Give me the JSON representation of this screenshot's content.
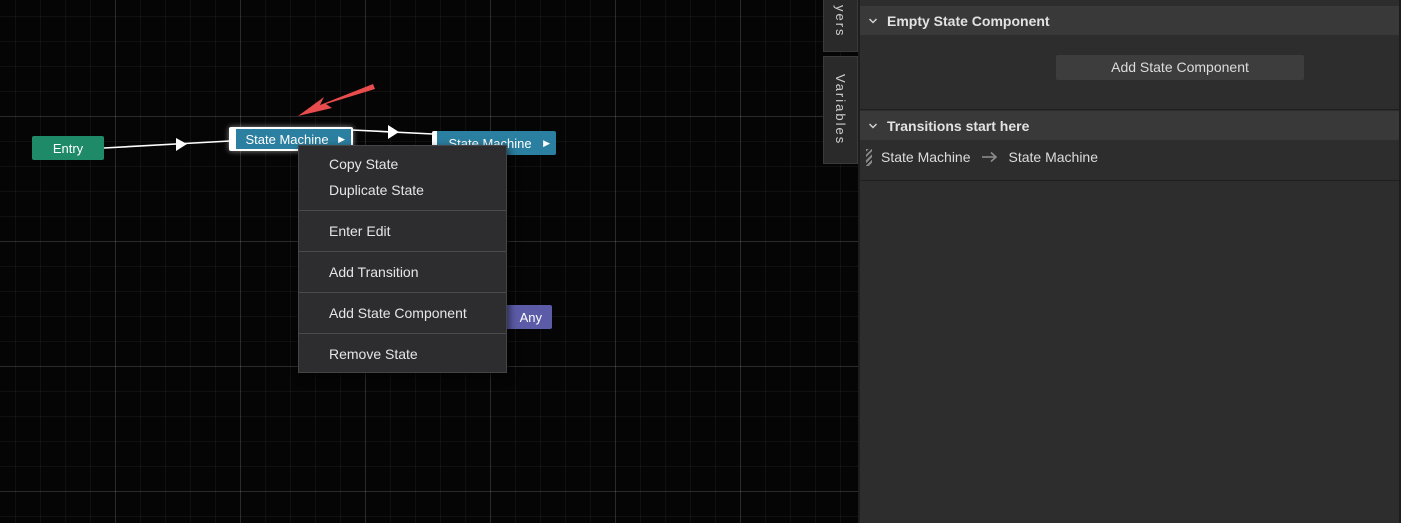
{
  "graph": {
    "nodes": {
      "entry": "Entry",
      "state_machine_1": "State Machine",
      "state_machine_2": "State Machine",
      "any": "Any"
    },
    "colors": {
      "entry": "#1e8a68",
      "state": "#2b7fa0",
      "any": "#5b5ba8",
      "annotation_arrow": "#e84c4c"
    }
  },
  "context_menu": {
    "items": [
      "Copy State",
      "Duplicate State",
      "Enter Edit",
      "Add Transition",
      "Add State Component",
      "Remove State"
    ]
  },
  "side_tabs": {
    "layers": "yers",
    "variables": "Variables"
  },
  "inspector": {
    "empty_component_section": {
      "title": "Empty State Component",
      "add_button": "Add State Component"
    },
    "transitions_section": {
      "title": "Transitions start here",
      "from": "State Machine",
      "to": "State Machine"
    }
  }
}
